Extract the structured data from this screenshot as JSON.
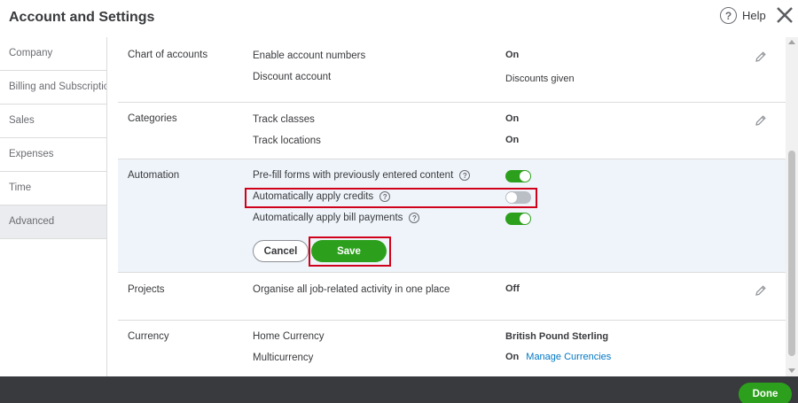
{
  "header": {
    "title": "Account and Settings",
    "help_label": "Help",
    "help_glyph": "?"
  },
  "sidebar": {
    "items": [
      {
        "label": "Company"
      },
      {
        "label": "Billing and Subscription"
      },
      {
        "label": "Sales"
      },
      {
        "label": "Expenses"
      },
      {
        "label": "Time"
      },
      {
        "label": "Advanced",
        "active": true
      }
    ]
  },
  "sections": {
    "chart_of_accounts": {
      "title": "Chart of accounts",
      "rows": [
        {
          "label": "Enable account numbers",
          "value": "On"
        },
        {
          "label": "Discount account",
          "value": "Discounts given"
        }
      ]
    },
    "categories": {
      "title": "Categories",
      "rows": [
        {
          "label": "Track classes",
          "value": "On"
        },
        {
          "label": "Track locations",
          "value": "On"
        }
      ]
    },
    "automation": {
      "title": "Automation",
      "rows": [
        {
          "label": "Pre-fill forms with previously entered content",
          "toggle": "on"
        },
        {
          "label": "Automatically apply credits",
          "toggle": "off"
        },
        {
          "label": "Automatically apply bill payments",
          "toggle": "on"
        }
      ],
      "cancel_label": "Cancel",
      "save_label": "Save"
    },
    "projects": {
      "title": "Projects",
      "rows": [
        {
          "label": "Organise all job-related activity in one place",
          "value": "Off"
        }
      ]
    },
    "currency": {
      "title": "Currency",
      "rows": [
        {
          "label": "Home Currency",
          "value": "British Pound Sterling"
        },
        {
          "label": "Multicurrency",
          "value": "On",
          "link": "Manage Currencies"
        }
      ]
    }
  },
  "footer": {
    "done_label": "Done"
  },
  "colors": {
    "accent_green": "#2ca01c",
    "highlight_red": "#d0021b",
    "link_blue": "#0077c5",
    "footer_bg": "#393a3d",
    "section_highlight_bg": "#eef4fa"
  },
  "icons": {
    "help": "question-circle-icon",
    "close": "close-icon",
    "edit": "pencil-icon",
    "info": "question-circle-icon"
  }
}
